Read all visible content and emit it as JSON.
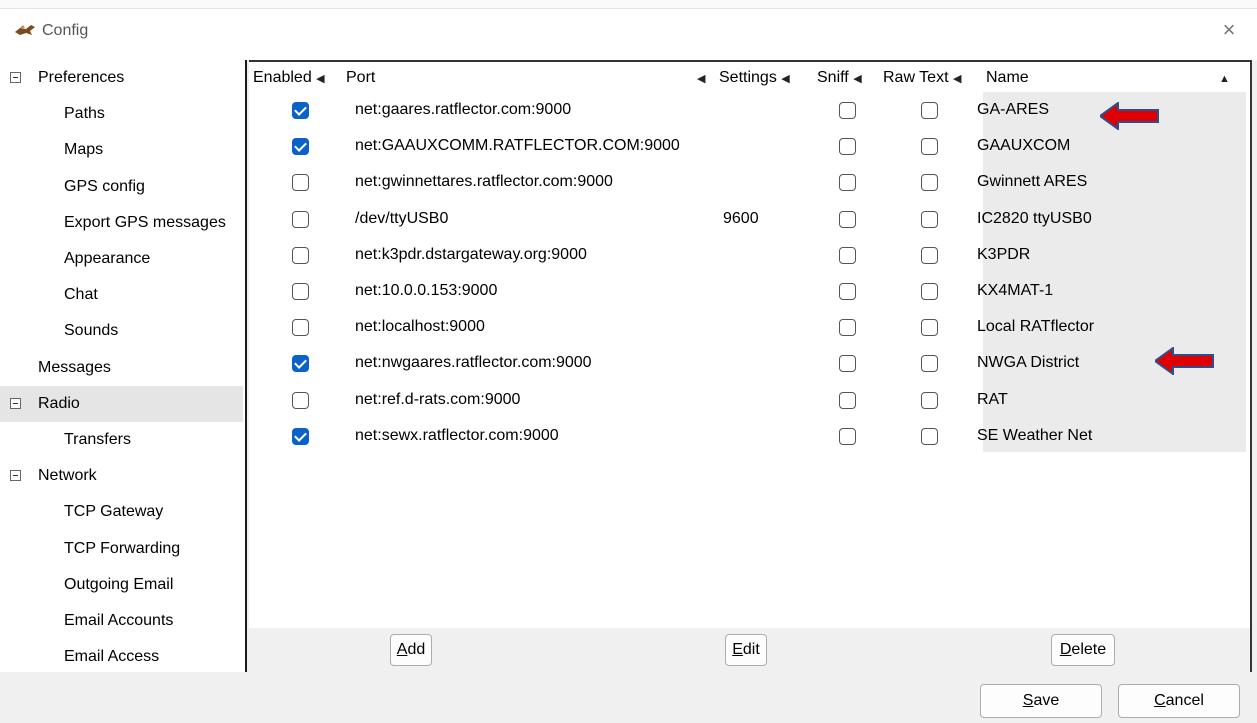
{
  "window": {
    "title": "Config",
    "close_glyph": "×"
  },
  "sidebar": {
    "items": [
      {
        "label": "Preferences",
        "expander": true
      },
      {
        "label": "Paths"
      },
      {
        "label": "Maps"
      },
      {
        "label": "GPS config"
      },
      {
        "label": "Export GPS messages"
      },
      {
        "label": "Appearance"
      },
      {
        "label": "Chat"
      },
      {
        "label": "Sounds"
      },
      {
        "label": "Messages"
      },
      {
        "label": "Radio",
        "expander": true,
        "selected": true
      },
      {
        "label": "Transfers"
      },
      {
        "label": "Network",
        "expander": true
      },
      {
        "label": "TCP Gateway"
      },
      {
        "label": "TCP Forwarding"
      },
      {
        "label": "Outgoing Email"
      },
      {
        "label": "Email Accounts"
      },
      {
        "label": "Email Access"
      }
    ]
  },
  "table": {
    "headers": {
      "enabled": "Enabled",
      "port": "Port",
      "settings": "Settings",
      "sniff": "Sniff",
      "raw_text": "Raw Text",
      "name": "Name",
      "collapse_arrow": "◀",
      "sort_arrow": "▲"
    },
    "rows": [
      {
        "enabled": true,
        "port": "net:gaares.ratflector.com:9000",
        "settings": "",
        "sniff": false,
        "raw": false,
        "name": "GA-ARES"
      },
      {
        "enabled": true,
        "port": "net:GAAUXCOMM.RATFLECTOR.COM:9000",
        "settings": "",
        "sniff": false,
        "raw": false,
        "name": "GAAUXCOM"
      },
      {
        "enabled": false,
        "port": "net:gwinnettares.ratflector.com:9000",
        "settings": "",
        "sniff": false,
        "raw": false,
        "name": "Gwinnett ARES"
      },
      {
        "enabled": false,
        "port": "/dev/ttyUSB0",
        "settings": "9600",
        "sniff": false,
        "raw": false,
        "name": "IC2820 ttyUSB0"
      },
      {
        "enabled": false,
        "port": "net:k3pdr.dstargateway.org:9000",
        "settings": "",
        "sniff": false,
        "raw": false,
        "name": "K3PDR"
      },
      {
        "enabled": false,
        "port": "net:10.0.0.153:9000",
        "settings": "",
        "sniff": false,
        "raw": false,
        "name": "KX4MAT-1"
      },
      {
        "enabled": false,
        "port": "net:localhost:9000",
        "settings": "",
        "sniff": false,
        "raw": false,
        "name": "Local RATflector"
      },
      {
        "enabled": true,
        "port": "net:nwgaares.ratflector.com:9000",
        "settings": "",
        "sniff": false,
        "raw": false,
        "name": "NWGA District"
      },
      {
        "enabled": false,
        "port": "net:ref.d-rats.com:9000",
        "settings": "",
        "sniff": false,
        "raw": false,
        "name": "RAT"
      },
      {
        "enabled": true,
        "port": "net:sewx.ratflector.com:9000",
        "settings": "",
        "sniff": false,
        "raw": false,
        "name": "SE Weather Net"
      }
    ]
  },
  "buttons": {
    "add": {
      "mnemonic": "A",
      "rest": "dd"
    },
    "edit": {
      "mnemonic": "E",
      "rest": "dit"
    },
    "delete": {
      "mnemonic": "D",
      "rest": "elete"
    },
    "save": {
      "mnemonic": "S",
      "rest": "ave"
    },
    "cancel": {
      "mnemonic": "C",
      "rest": "ancel"
    }
  },
  "annotations": {
    "arrow_color": "#e00000"
  }
}
